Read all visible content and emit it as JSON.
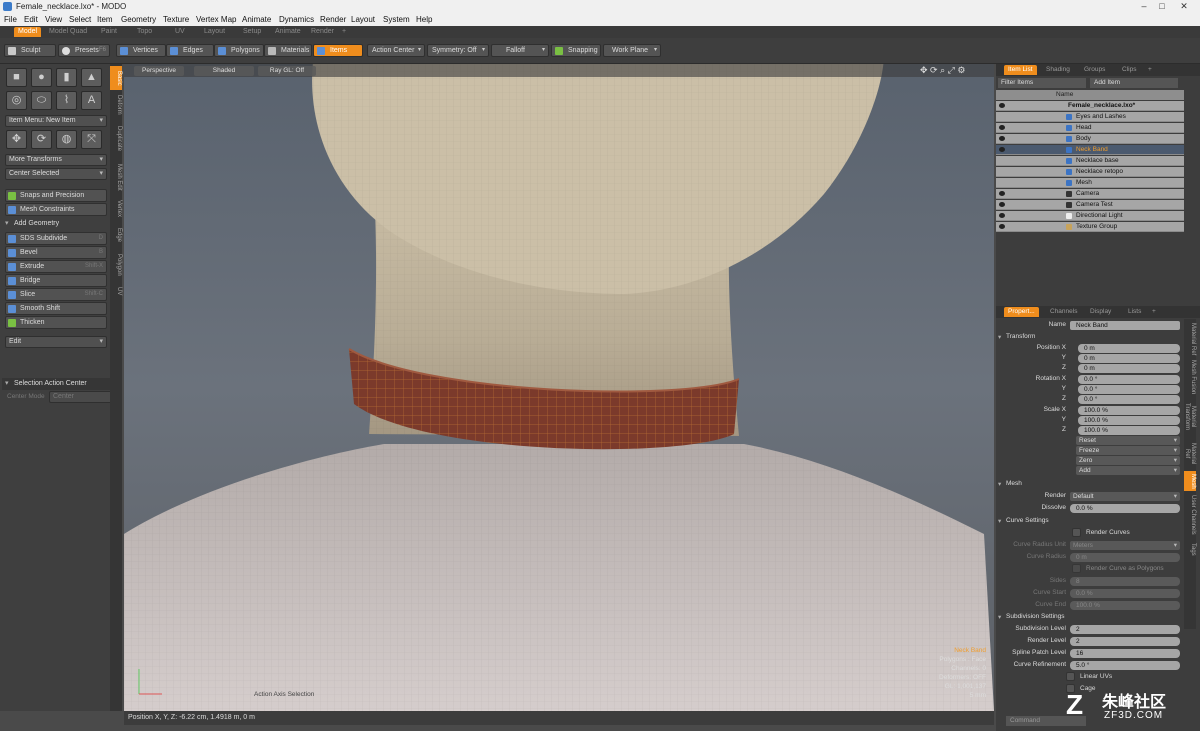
{
  "window": {
    "title": "Female_necklace.lxo* - MODO"
  },
  "menu": [
    "File",
    "Edit",
    "View",
    "Select",
    "Item",
    "Geometry",
    "Texture",
    "Vertex Map",
    "Animate",
    "Dynamics",
    "Render",
    "Layout",
    "System",
    "Help"
  ],
  "layout_tabs": [
    {
      "label": "Model",
      "active": true
    },
    {
      "label": "Model Quad"
    },
    {
      "label": "Paint"
    },
    {
      "label": "Topo"
    },
    {
      "label": "UV"
    },
    {
      "label": "Layout"
    },
    {
      "label": "Setup"
    },
    {
      "label": "Animate"
    },
    {
      "label": "Render"
    },
    {
      "label": "+"
    }
  ],
  "toolbar": {
    "sculpt": "Sculpt",
    "presets": "Presets",
    "presets_key": "F6",
    "vertices": "Vertices",
    "vertices_key": "1",
    "edges": "Edges",
    "edges_key": "2",
    "polygons": "Polygons",
    "polygons_key": "3",
    "materials": "Materials",
    "items": "Items",
    "action_center": "Action Center",
    "symmetry": "Symmetry: Off",
    "falloff": "Falloff",
    "snapping": "Snapping",
    "work_plane": "Work Plane"
  },
  "left": {
    "item_menu": "Item Menu: New Item",
    "more_transforms": "More Transforms",
    "center_selected": "Center Selected",
    "snaps": "Snaps and Precision",
    "mesh_constraints": "Mesh Constraints",
    "add_geometry": "Add Geometry",
    "tools": [
      {
        "label": "SDS Subdivide",
        "key": "D"
      },
      {
        "label": "Bevel",
        "key": "B"
      },
      {
        "label": "Extrude",
        "key": "Shift-X"
      },
      {
        "label": "Bridge",
        "key": ""
      },
      {
        "label": "Slice",
        "key": "Shift-C"
      },
      {
        "label": "Smooth Shift",
        "key": ""
      },
      {
        "label": "Thicken",
        "key": ""
      }
    ],
    "edit": "Edit",
    "selection_action_center": "Selection Action Center",
    "center_mode_label": "Center Mode",
    "center_mode_value": "Center",
    "side_tabs": [
      "Basic",
      "Deform",
      "Duplicate",
      "Mesh Edit",
      "Vertex",
      "Edge",
      "Polygon",
      "UV"
    ]
  },
  "viewport": {
    "view": "Perspective",
    "shading": "Shaded",
    "raygl": "Ray GL: Off",
    "info_name": "Neck Band",
    "info_polys": "Polygons : Face",
    "info_channels": "Channels: 0",
    "info_deformers": "Deformers: OFF",
    "info_gl": "GL: 1,001,137",
    "info_scale": "5 mm",
    "hint": "Action Axis Selection",
    "status": "Position X, Y, Z:  -6.22 cm, 1.4918 m, 0 m"
  },
  "right": {
    "tabs": [
      "Item List",
      "Shading",
      "Groups",
      "Clips",
      "+"
    ],
    "filter": "Filter Items",
    "add_item": "Add Item",
    "col_name": "Name",
    "items": [
      {
        "label": "Female_necklace.lxo*",
        "bold": true
      },
      {
        "label": "Eyes and Lashes"
      },
      {
        "label": "Head"
      },
      {
        "label": "Body"
      },
      {
        "label": "Neck Band",
        "selected": true
      },
      {
        "label": "Necklace base"
      },
      {
        "label": "Necklace retopo"
      },
      {
        "label": "Mesh"
      },
      {
        "label": "Camera"
      },
      {
        "label": "Camera Test"
      },
      {
        "label": "Directional Light"
      },
      {
        "label": "Texture Group"
      }
    ],
    "prop_tabs": [
      "Propert...",
      "Channels",
      "Display",
      "Lists",
      "+"
    ],
    "name_label": "Name",
    "name_value": "Neck Band",
    "transform": "Transform",
    "position_label": "Position X",
    "pos": [
      "0 m",
      "0 m",
      "0 m"
    ],
    "rotation_label": "Rotation X",
    "rot": [
      "0.0 °",
      "0.0 °",
      "0.0 °"
    ],
    "scale_label": "Scale X",
    "scl": [
      "100.0 %",
      "100.0 %",
      "100.0 %"
    ],
    "axis_y": "Y",
    "axis_z": "Z",
    "actions": [
      "Reset",
      "Freeze",
      "Zero",
      "Add"
    ],
    "mesh": "Mesh",
    "render_label": "Render",
    "render_value": "Default",
    "dissolve_label": "Dissolve",
    "dissolve_value": "0.0 %",
    "curve_settings": "Curve Settings",
    "render_curves": "Render Curves",
    "curve_radius_unit_label": "Curve Radius Unit",
    "curve_radius_unit": "Meters",
    "curve_radius_label": "Curve Radius",
    "curve_radius": "0 m",
    "render_curve_polys": "Render Curve as Polygons",
    "sides_label": "Sides",
    "sides": "8",
    "curve_start_label": "Curve Start",
    "curve_start": "0.0 %",
    "curve_end_label": "Curve End",
    "curve_end": "100.0 %",
    "subdiv_settings": "Subdivision Settings",
    "subdiv_level_label": "Subdivision Level",
    "subdiv_level": "2",
    "render_level_label": "Render Level",
    "render_level": "2",
    "spline_label": "Spline Patch Level",
    "spline": "16",
    "refine_label": "Curve Refinement",
    "refine": "5.0 °",
    "linear_uvs": "Linear UVs",
    "cage": "Cage",
    "side_tabs": [
      "Material Ref",
      "Mesh Fusion",
      "Material Transform",
      "Material Ref",
      "Mesh",
      "User Channels",
      "Tags"
    ],
    "command": "Command"
  },
  "watermark": {
    "line1": "朱峰社区",
    "line2": "ZF3D.COM"
  }
}
